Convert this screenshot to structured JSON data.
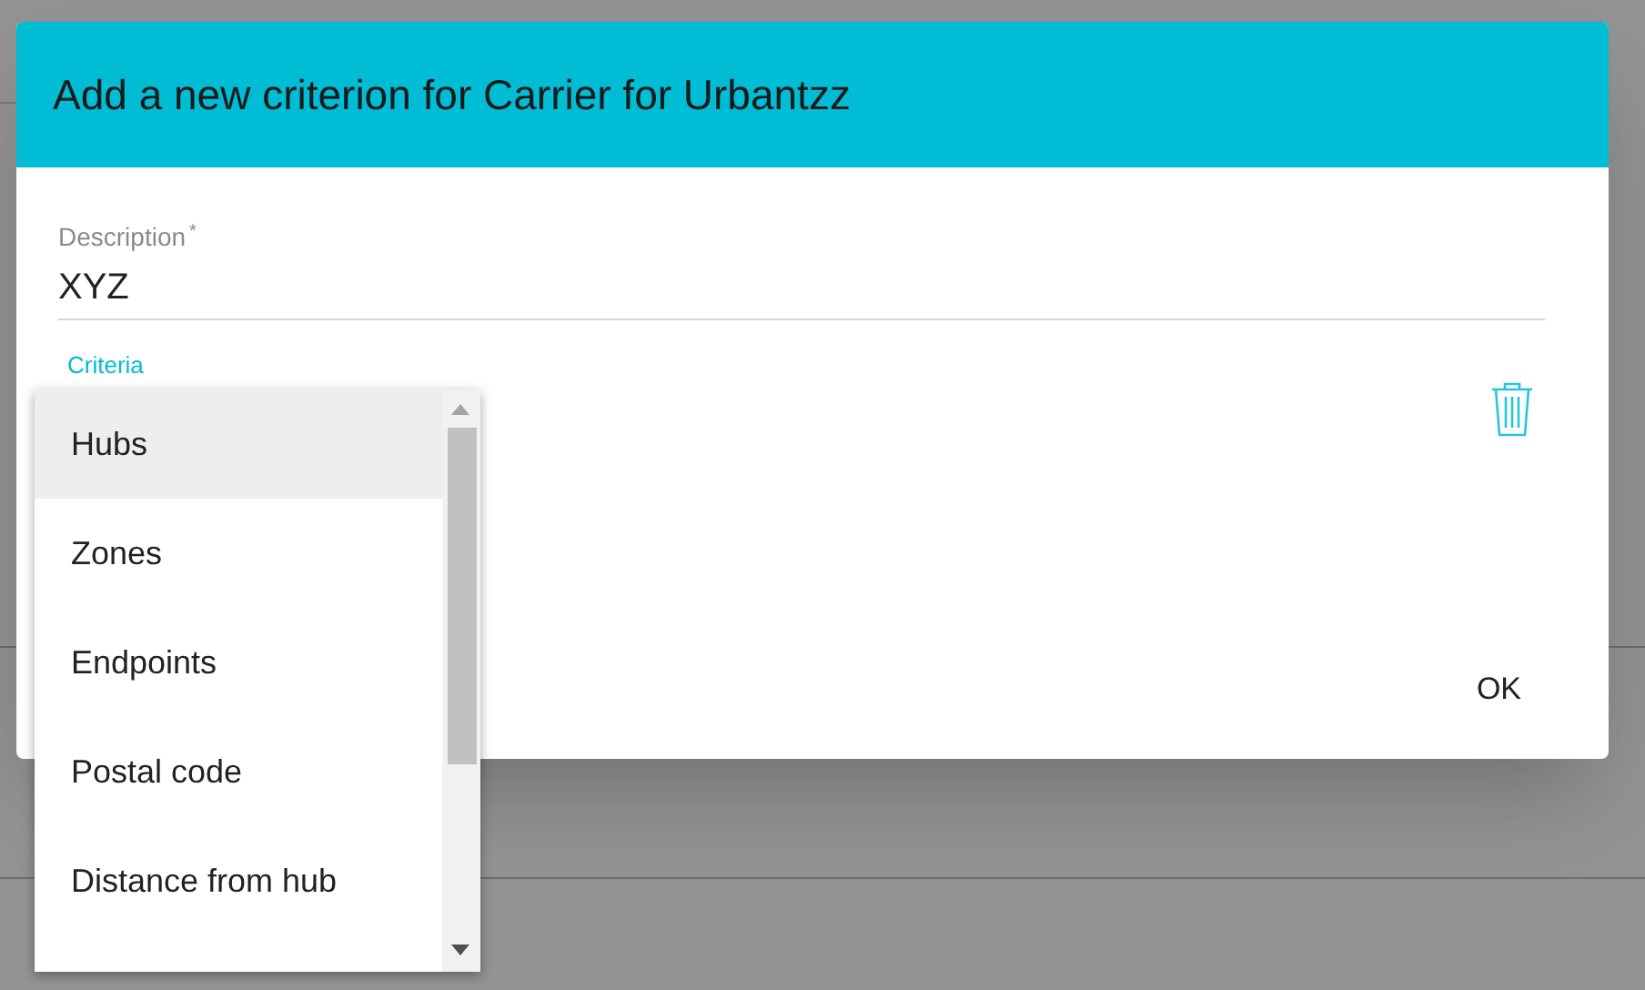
{
  "dialog": {
    "title": "Add a new criterion for Carrier for Urbantzz",
    "description": {
      "label": "Description",
      "required_mark": "*",
      "value": "XYZ"
    },
    "criteria": {
      "label": "Criteria"
    },
    "buttons": [
      "OK"
    ]
  },
  "dropdown": {
    "items": [
      {
        "label": "Hubs",
        "selected": true
      },
      {
        "label": "Zones",
        "selected": false
      },
      {
        "label": "Endpoints",
        "selected": false
      },
      {
        "label": "Postal code",
        "selected": false
      },
      {
        "label": "Distance from hub",
        "selected": false
      }
    ]
  }
}
